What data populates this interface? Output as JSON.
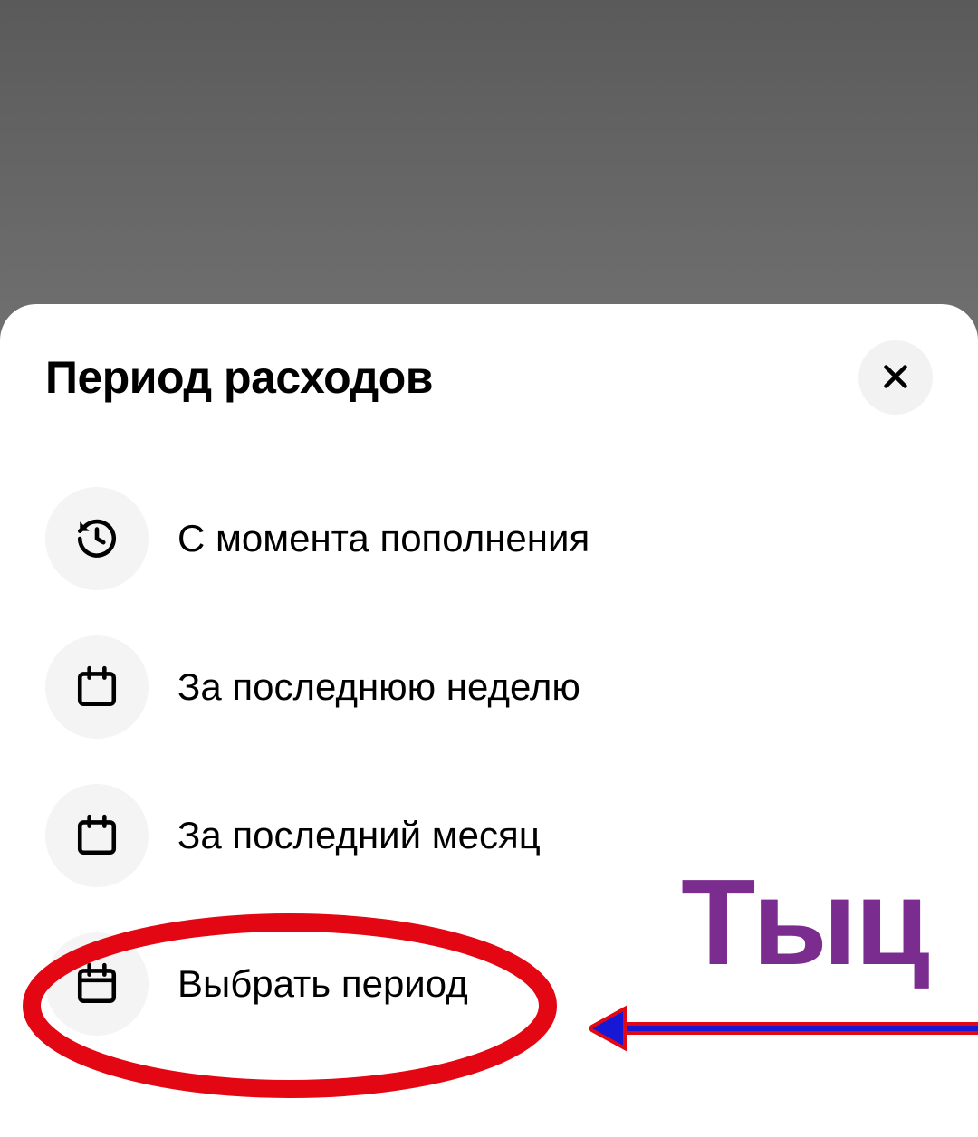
{
  "sheet": {
    "title": "Период расходов",
    "options": [
      {
        "label": "С момента пополнения",
        "icon": "history-icon"
      },
      {
        "label": "За последнюю неделю",
        "icon": "calendar-week-icon"
      },
      {
        "label": "За последний месяц",
        "icon": "calendar-month-icon"
      },
      {
        "label": "Выбрать период",
        "icon": "calendar-icon"
      }
    ]
  },
  "annotation": {
    "text": "Тыц"
  }
}
